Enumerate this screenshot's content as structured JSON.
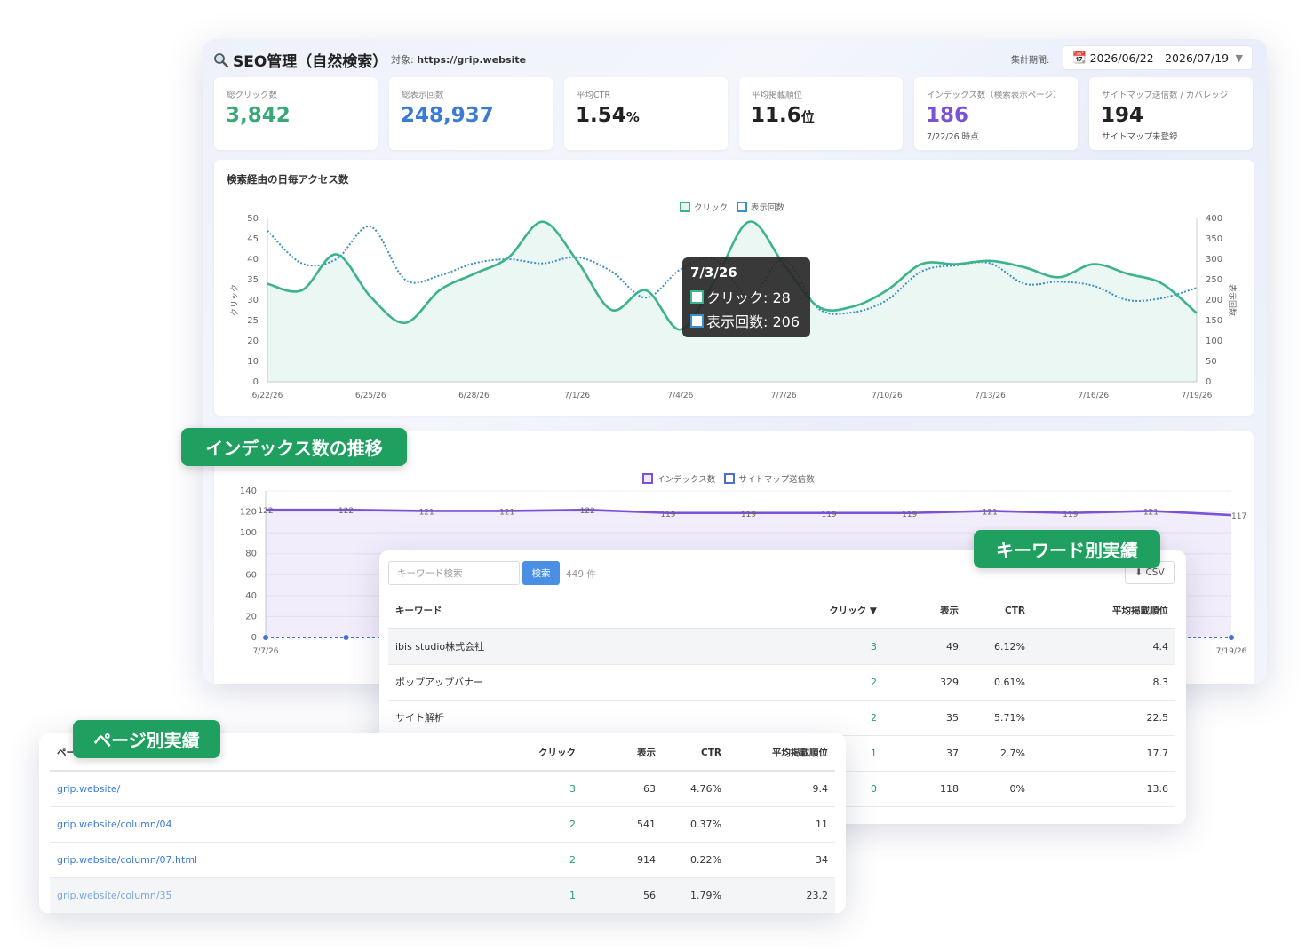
{
  "header": {
    "title": "SEO管理（自然検索）",
    "target_label": "対象:",
    "target_url": "https://grip.website",
    "period_label": "集計期間:",
    "period_value": "2026/06/22 - 2026/07/19"
  },
  "kpis": [
    {
      "label": "総クリック数",
      "value": "3,842",
      "unit": "",
      "sub": "",
      "color": "#3aa876"
    },
    {
      "label": "総表示回数",
      "value": "248,937",
      "unit": "",
      "sub": "",
      "color": "#3a7bd5"
    },
    {
      "label": "平均CTR",
      "value": "1.54",
      "unit": "%",
      "sub": "",
      "color": "#222222"
    },
    {
      "label": "平均掲載順位",
      "value": "11.6",
      "unit": "位",
      "sub": "",
      "color": "#222222"
    },
    {
      "label": "インデックス数（検索表示ページ）",
      "value": "186",
      "unit": "",
      "sub": "7/22/26 時点",
      "color": "#7b52d6"
    },
    {
      "label": "サイトマップ送信数 / カバレッジ",
      "value": "194",
      "unit": "",
      "sub": "サイトマップ未登録",
      "color": "#222222"
    }
  ],
  "access_chart": {
    "title": "検索経由の日毎アクセス数",
    "legend": [
      "クリック",
      "表示回数"
    ],
    "y_left_label": "クリック",
    "y_right_label": "表示回数",
    "tooltip": {
      "date": "7/3/26",
      "click": "クリック: 28",
      "impr": "表示回数: 206"
    }
  },
  "index_chart": {
    "legend": [
      "インデックス数",
      "サイトマップ送信数"
    ]
  },
  "badges": {
    "index": "インデックス数の推移",
    "keyword": "キーワード別実績",
    "page": "ページ別実績"
  },
  "keyword_table": {
    "search_placeholder": "キーワード検索",
    "search_button": "検索",
    "count": "449 件",
    "csv": "⬇ CSV",
    "headers": [
      "キーワード",
      "クリック ▼",
      "表示",
      "CTR",
      "平均掲載順位"
    ],
    "rows": [
      [
        "ibis studio株式会社",
        "3",
        "49",
        "6.12%",
        "4.4"
      ],
      [
        "ポップアップバナー",
        "2",
        "329",
        "0.61%",
        "8.3"
      ],
      [
        "サイト解析",
        "2",
        "35",
        "5.71%",
        "22.5"
      ],
      [
        "",
        "1",
        "37",
        "2.7%",
        "17.7"
      ],
      [
        "",
        "0",
        "118",
        "0%",
        "13.6"
      ]
    ]
  },
  "page_table": {
    "headers": [
      "ペー",
      "クリック",
      "表示",
      "CTR",
      "平均掲載順位"
    ],
    "rows": [
      [
        "grip.website/",
        "3",
        "63",
        "4.76%",
        "9.4"
      ],
      [
        "grip.website/column/04",
        "2",
        "541",
        "0.37%",
        "11"
      ],
      [
        "grip.website/column/07.html",
        "2",
        "914",
        "0.22%",
        "34"
      ],
      [
        "grip.website/column/35",
        "1",
        "56",
        "1.79%",
        "23.2"
      ]
    ]
  },
  "chart_data": [
    {
      "type": "line",
      "title": "検索経由の日毎アクセス数",
      "x_ticks": [
        "6/22/26",
        "6/25/26",
        "6/28/26",
        "7/1/26",
        "7/4/26",
        "7/7/26",
        "7/10/26",
        "7/13/26",
        "7/16/26",
        "7/19/26"
      ],
      "series": [
        {
          "name": "クリック",
          "axis": "left",
          "color": "#3cb48a",
          "x": [
            "6/22/26",
            "6/23/26",
            "6/24/26",
            "6/25/26",
            "6/26/26",
            "6/27/26",
            "6/28/26",
            "6/29/26",
            "6/30/26",
            "7/1/26",
            "7/2/26",
            "7/3/26",
            "7/4/26",
            "7/5/26",
            "7/6/26",
            "7/7/26",
            "7/8/26",
            "7/9/26",
            "7/10/26",
            "7/11/26",
            "7/12/26",
            "7/13/26",
            "7/14/26",
            "7/15/26",
            "7/16/26",
            "7/17/26",
            "7/18/26",
            "7/19/26"
          ],
          "values": [
            30,
            28,
            39,
            26,
            18,
            28,
            33,
            38,
            49,
            37,
            22,
            28,
            16,
            31,
            49,
            36,
            23,
            23,
            28,
            36,
            36,
            37,
            35,
            32,
            36,
            33,
            30,
            21
          ]
        },
        {
          "name": "表示回数",
          "axis": "right",
          "color": "#3a8fc8",
          "x": [
            "6/22/26",
            "6/23/26",
            "6/24/26",
            "6/25/26",
            "6/26/26",
            "6/27/26",
            "6/28/26",
            "6/29/26",
            "6/30/26",
            "7/1/26",
            "7/2/26",
            "7/3/26",
            "7/4/26",
            "7/5/26",
            "7/6/26",
            "7/7/26",
            "7/8/26",
            "7/9/26",
            "7/10/26",
            "7/11/26",
            "7/12/26",
            "7/13/26",
            "7/14/26",
            "7/15/26",
            "7/16/26",
            "7/17/26",
            "7/18/26",
            "7/19/26"
          ],
          "values": [
            370,
            290,
            300,
            380,
            250,
            260,
            290,
            300,
            290,
            305,
            270,
            206,
            275,
            300,
            210,
            300,
            180,
            170,
            200,
            270,
            285,
            290,
            240,
            245,
            235,
            200,
            205,
            230
          ]
        }
      ],
      "ylim_left": [
        0,
        50
      ],
      "y_left_ticks": [
        0,
        10,
        20,
        25,
        30,
        35,
        40,
        45,
        50
      ],
      "ylim_right": [
        0,
        400
      ],
      "y_right_ticks": [
        0,
        50,
        100,
        150,
        200,
        250,
        300,
        350,
        400
      ],
      "ylabel_left": "クリック",
      "ylabel_right": "表示回数",
      "legend": "top-center"
    },
    {
      "type": "area",
      "x_ticks": [
        "7/7/26",
        "7/19/26"
      ],
      "series": [
        {
          "name": "インデックス数",
          "color": "#7b52d6",
          "values": [
            122,
            122,
            121,
            121,
            122,
            119,
            119,
            119,
            119,
            121,
            119,
            121,
            117
          ],
          "labels": [
            "122",
            "122",
            "121",
            "121",
            "122",
            "119",
            "119",
            "119",
            "119",
            "121",
            "119",
            "121",
            "117"
          ]
        },
        {
          "name": "サイトマップ送信数",
          "color": "#4a6fd0",
          "values": [
            0,
            0,
            0,
            0,
            0,
            0,
            0,
            0,
            0,
            0,
            0,
            0,
            0
          ]
        }
      ],
      "ylim": [
        0,
        140
      ],
      "y_ticks": [
        0,
        20,
        40,
        60,
        80,
        100,
        120,
        140
      ],
      "legend": "top-center"
    }
  ]
}
